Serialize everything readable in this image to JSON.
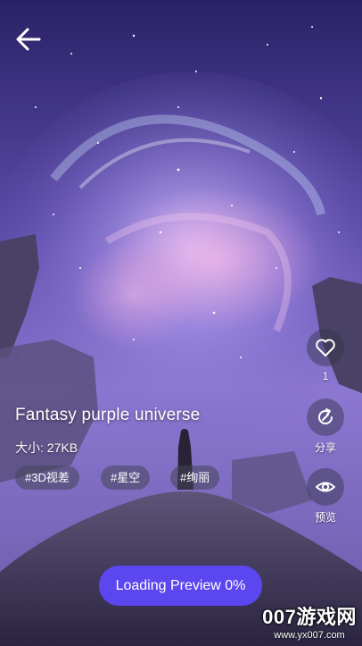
{
  "wallpaper": {
    "title": "Fantasy purple universe",
    "size_text": "大小: 27KB",
    "tags": [
      "#3D视差",
      "#星空",
      "#绚丽"
    ]
  },
  "actions": {
    "like_count": "1",
    "share_label": "分享",
    "preview_label": "预览"
  },
  "loading": {
    "label": "Loading Preview 0%"
  },
  "watermark": {
    "brand": "007游戏网",
    "url": "www.yx007.com"
  },
  "colors": {
    "accent": "#5b46f0",
    "sky_top": "#2a2266",
    "sky_glow": "#b9a8f0",
    "nebula_pink": "#e79ad8",
    "rock": "#4a4266"
  },
  "icons": {
    "back": "arrow-left-icon",
    "like": "heart-icon",
    "share": "share-icon",
    "preview": "eye-icon"
  }
}
